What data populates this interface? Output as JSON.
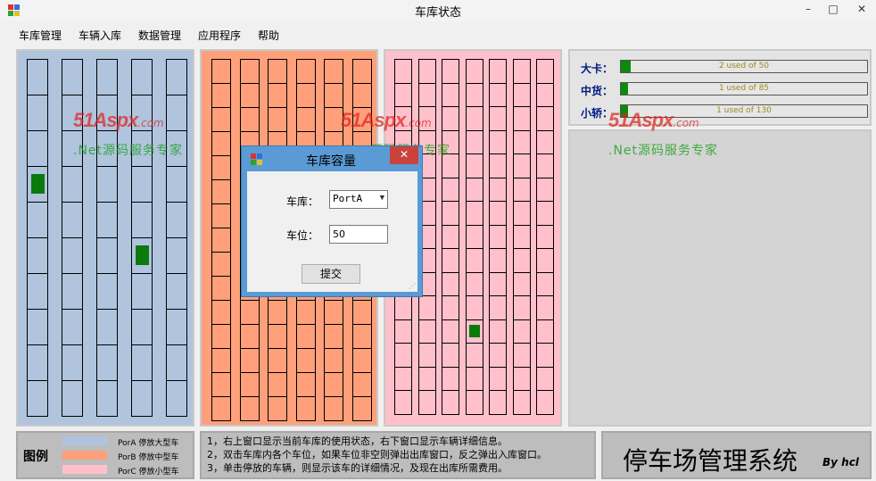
{
  "window": {
    "title": "车库状态",
    "minimize": "–",
    "maximize": "□",
    "close": "✕"
  },
  "menu": {
    "items": [
      "车库管理",
      "车辆入库",
      "数据管理",
      "应用程序",
      "帮助"
    ]
  },
  "garages": {
    "porA": {
      "color": "#b0c4de",
      "columns": 5,
      "rows": 10,
      "occupied": [
        [
          0,
          3
        ],
        [
          3,
          5
        ]
      ]
    },
    "porB": {
      "color": "#ffa07a",
      "columns": 6,
      "rows": 15,
      "occupied": []
    },
    "porC": {
      "color": "#ffc0cb",
      "columns": 7,
      "rows": 15,
      "occupied": [
        [
          3,
          11
        ]
      ]
    }
  },
  "status": {
    "items": [
      {
        "label": "大卡：",
        "text": "2 used of 50",
        "used": 2,
        "total": 50
      },
      {
        "label": "中货：",
        "text": "1 used of 85",
        "used": 1,
        "total": 85
      },
      {
        "label": "小轿：",
        "text": "1 used of 130",
        "used": 1,
        "total": 130
      }
    ]
  },
  "legend": {
    "title": "图例",
    "items": [
      {
        "color": "#b0c4de",
        "text": "PorA 停放大型车"
      },
      {
        "color": "#ffa07a",
        "text": "PorB 停放中型车"
      },
      {
        "color": "#ffc0cb",
        "text": "PorC 停放小型车"
      }
    ]
  },
  "notes": {
    "lines": [
      "1，右上窗口显示当前车库的使用状态，右下窗口显示车辆详细信息。",
      "2，双击车库内各个车位，如果车位非空则弹出出库窗口，反之弹出入库窗口。",
      "3，单击停放的车辆，则显示该车的详细情况，及现在出库所需费用。"
    ]
  },
  "brand": {
    "title": "停车场管理系统",
    "by": "By hcl"
  },
  "dialog": {
    "title": "车库容量",
    "close": "✕",
    "garage_label": "车库：",
    "garage_value": "PortA",
    "slot_label": "车位：",
    "slot_value": "50",
    "submit": "提交"
  },
  "watermark": {
    "logo": "51Aspx",
    "com": ".com",
    "sub": ".Net源码服务专家"
  }
}
